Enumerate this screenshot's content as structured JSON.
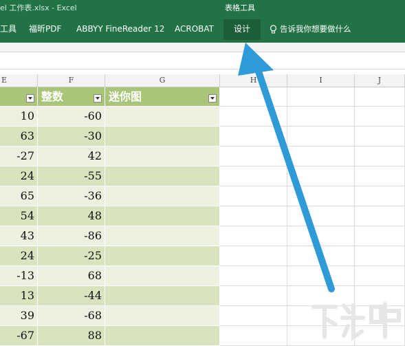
{
  "window": {
    "title": "el 工作表.xlsx  -  Excel",
    "context_tab_title": "表格工具"
  },
  "ribbon": {
    "tabs": [
      {
        "label": "工具"
      },
      {
        "label": "福昕PDF"
      },
      {
        "label": "ABBYY FineReader 12"
      },
      {
        "label": "ACROBAT"
      },
      {
        "label": "设计",
        "active": true
      }
    ],
    "tell_me": "告诉我你想要做什么"
  },
  "columns": [
    "E",
    "F",
    "G",
    "H",
    "I",
    "J"
  ],
  "table": {
    "headers": {
      "f": "整数",
      "g": "迷你图"
    },
    "rows": [
      {
        "e": "10",
        "f": "-60"
      },
      {
        "e": "63",
        "f": "-30"
      },
      {
        "e": "-27",
        "f": "42"
      },
      {
        "e": "24",
        "f": "-55"
      },
      {
        "e": "65",
        "f": "-36"
      },
      {
        "e": "54",
        "f": "48"
      },
      {
        "e": "43",
        "f": "-86"
      },
      {
        "e": "24",
        "f": "-25"
      },
      {
        "e": "-13",
        "f": "68"
      },
      {
        "e": "13",
        "f": "-44"
      },
      {
        "e": "39",
        "f": "-68"
      },
      {
        "e": "-67",
        "f": "88"
      }
    ]
  },
  "colors": {
    "ribbon": "#217346",
    "header_fill": "#a9c579",
    "band_dark": "#d7e4bd",
    "band_light": "#ebf1de",
    "arrow": "#2f9ad8"
  },
  "watermark": {
    "text": "下载吧"
  }
}
